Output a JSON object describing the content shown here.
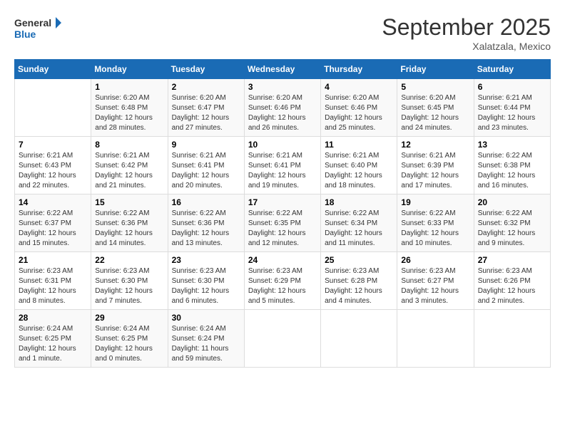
{
  "header": {
    "logo_line1": "General",
    "logo_line2": "Blue",
    "month": "September 2025",
    "location": "Xalatzala, Mexico"
  },
  "days_of_week": [
    "Sunday",
    "Monday",
    "Tuesday",
    "Wednesday",
    "Thursday",
    "Friday",
    "Saturday"
  ],
  "weeks": [
    [
      {
        "num": "",
        "info": ""
      },
      {
        "num": "1",
        "info": "Sunrise: 6:20 AM\nSunset: 6:48 PM\nDaylight: 12 hours\nand 28 minutes."
      },
      {
        "num": "2",
        "info": "Sunrise: 6:20 AM\nSunset: 6:47 PM\nDaylight: 12 hours\nand 27 minutes."
      },
      {
        "num": "3",
        "info": "Sunrise: 6:20 AM\nSunset: 6:46 PM\nDaylight: 12 hours\nand 26 minutes."
      },
      {
        "num": "4",
        "info": "Sunrise: 6:20 AM\nSunset: 6:46 PM\nDaylight: 12 hours\nand 25 minutes."
      },
      {
        "num": "5",
        "info": "Sunrise: 6:20 AM\nSunset: 6:45 PM\nDaylight: 12 hours\nand 24 minutes."
      },
      {
        "num": "6",
        "info": "Sunrise: 6:21 AM\nSunset: 6:44 PM\nDaylight: 12 hours\nand 23 minutes."
      }
    ],
    [
      {
        "num": "7",
        "info": "Sunrise: 6:21 AM\nSunset: 6:43 PM\nDaylight: 12 hours\nand 22 minutes."
      },
      {
        "num": "8",
        "info": "Sunrise: 6:21 AM\nSunset: 6:42 PM\nDaylight: 12 hours\nand 21 minutes."
      },
      {
        "num": "9",
        "info": "Sunrise: 6:21 AM\nSunset: 6:41 PM\nDaylight: 12 hours\nand 20 minutes."
      },
      {
        "num": "10",
        "info": "Sunrise: 6:21 AM\nSunset: 6:41 PM\nDaylight: 12 hours\nand 19 minutes."
      },
      {
        "num": "11",
        "info": "Sunrise: 6:21 AM\nSunset: 6:40 PM\nDaylight: 12 hours\nand 18 minutes."
      },
      {
        "num": "12",
        "info": "Sunrise: 6:21 AM\nSunset: 6:39 PM\nDaylight: 12 hours\nand 17 minutes."
      },
      {
        "num": "13",
        "info": "Sunrise: 6:22 AM\nSunset: 6:38 PM\nDaylight: 12 hours\nand 16 minutes."
      }
    ],
    [
      {
        "num": "14",
        "info": "Sunrise: 6:22 AM\nSunset: 6:37 PM\nDaylight: 12 hours\nand 15 minutes."
      },
      {
        "num": "15",
        "info": "Sunrise: 6:22 AM\nSunset: 6:36 PM\nDaylight: 12 hours\nand 14 minutes."
      },
      {
        "num": "16",
        "info": "Sunrise: 6:22 AM\nSunset: 6:36 PM\nDaylight: 12 hours\nand 13 minutes."
      },
      {
        "num": "17",
        "info": "Sunrise: 6:22 AM\nSunset: 6:35 PM\nDaylight: 12 hours\nand 12 minutes."
      },
      {
        "num": "18",
        "info": "Sunrise: 6:22 AM\nSunset: 6:34 PM\nDaylight: 12 hours\nand 11 minutes."
      },
      {
        "num": "19",
        "info": "Sunrise: 6:22 AM\nSunset: 6:33 PM\nDaylight: 12 hours\nand 10 minutes."
      },
      {
        "num": "20",
        "info": "Sunrise: 6:22 AM\nSunset: 6:32 PM\nDaylight: 12 hours\nand 9 minutes."
      }
    ],
    [
      {
        "num": "21",
        "info": "Sunrise: 6:23 AM\nSunset: 6:31 PM\nDaylight: 12 hours\nand 8 minutes."
      },
      {
        "num": "22",
        "info": "Sunrise: 6:23 AM\nSunset: 6:30 PM\nDaylight: 12 hours\nand 7 minutes."
      },
      {
        "num": "23",
        "info": "Sunrise: 6:23 AM\nSunset: 6:30 PM\nDaylight: 12 hours\nand 6 minutes."
      },
      {
        "num": "24",
        "info": "Sunrise: 6:23 AM\nSunset: 6:29 PM\nDaylight: 12 hours\nand 5 minutes."
      },
      {
        "num": "25",
        "info": "Sunrise: 6:23 AM\nSunset: 6:28 PM\nDaylight: 12 hours\nand 4 minutes."
      },
      {
        "num": "26",
        "info": "Sunrise: 6:23 AM\nSunset: 6:27 PM\nDaylight: 12 hours\nand 3 minutes."
      },
      {
        "num": "27",
        "info": "Sunrise: 6:23 AM\nSunset: 6:26 PM\nDaylight: 12 hours\nand 2 minutes."
      }
    ],
    [
      {
        "num": "28",
        "info": "Sunrise: 6:24 AM\nSunset: 6:25 PM\nDaylight: 12 hours\nand 1 minute."
      },
      {
        "num": "29",
        "info": "Sunrise: 6:24 AM\nSunset: 6:25 PM\nDaylight: 12 hours\nand 0 minutes."
      },
      {
        "num": "30",
        "info": "Sunrise: 6:24 AM\nSunset: 6:24 PM\nDaylight: 11 hours\nand 59 minutes."
      },
      {
        "num": "",
        "info": ""
      },
      {
        "num": "",
        "info": ""
      },
      {
        "num": "",
        "info": ""
      },
      {
        "num": "",
        "info": ""
      }
    ]
  ]
}
